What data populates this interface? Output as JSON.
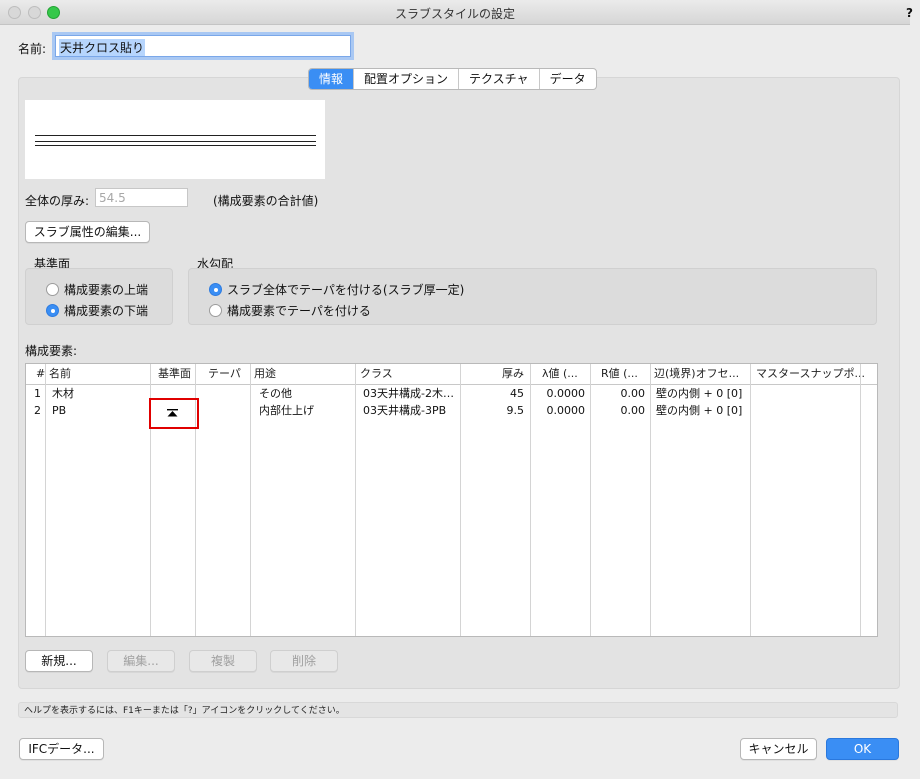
{
  "window": {
    "title": "スラブスタイルの設定",
    "help_icon": "?"
  },
  "name_field": {
    "label": "名前:",
    "value": "天井クロス貼り"
  },
  "tabs": [
    {
      "label": "情報",
      "active": true
    },
    {
      "label": "配置オプション",
      "active": false
    },
    {
      "label": "テクスチャ",
      "active": false
    },
    {
      "label": "データ",
      "active": false
    }
  ],
  "thickness": {
    "label": "全体の厚み:",
    "value": "54.5",
    "note": "(構成要素の合計値)"
  },
  "edit_attrs_button": "スラブ属性の編集...",
  "reference": {
    "label": "基準面",
    "options": [
      {
        "label": "構成要素の上端",
        "selected": false
      },
      {
        "label": "構成要素の下端",
        "selected": true
      }
    ]
  },
  "slope": {
    "label": "水勾配",
    "options": [
      {
        "label": "スラブ全体でテーパを付ける(スラブ厚一定)",
        "selected": true
      },
      {
        "label": "構成要素でテーパを付ける",
        "selected": false
      }
    ]
  },
  "components": {
    "label": "構成要素:",
    "headers": {
      "num": "#",
      "name": "名前",
      "ref": "基準面",
      "taper": "テーパ",
      "usage": "用途",
      "class": "クラス",
      "thick": "厚み",
      "lambda": "λ値 (...",
      "r": "R値 (...",
      "offset": "辺(境界)オフセ...",
      "snap": "マスタースナップポ..."
    },
    "rows": [
      {
        "num": "1",
        "name": "木材",
        "ref": "",
        "taper": "",
        "usage": "その他",
        "class": "03天井構成-2木…",
        "thick": "45",
        "lambda": "0.0000",
        "r": "0.00",
        "offset": "壁の内側 + 0 [0]",
        "snap": ""
      },
      {
        "num": "2",
        "name": "PB",
        "ref": "up-arrow-icon",
        "taper": "",
        "usage": "内部仕上げ",
        "class": "03天井構成-3PB",
        "thick": "9.5",
        "lambda": "0.0000",
        "r": "0.00",
        "offset": "壁の内側 + 0 [0]",
        "snap": ""
      }
    ]
  },
  "list_buttons": {
    "new": "新規...",
    "edit": "編集...",
    "duplicate": "複製",
    "delete": "削除"
  },
  "status": "ヘルプを表示するには、F1キーまたは「?」アイコンをクリックしてください。",
  "footer": {
    "ifc": "IFCデータ...",
    "cancel": "キャンセル",
    "ok": "OK"
  },
  "colors": {
    "accent": "#3a8ef4",
    "highlight": "#e00000"
  }
}
